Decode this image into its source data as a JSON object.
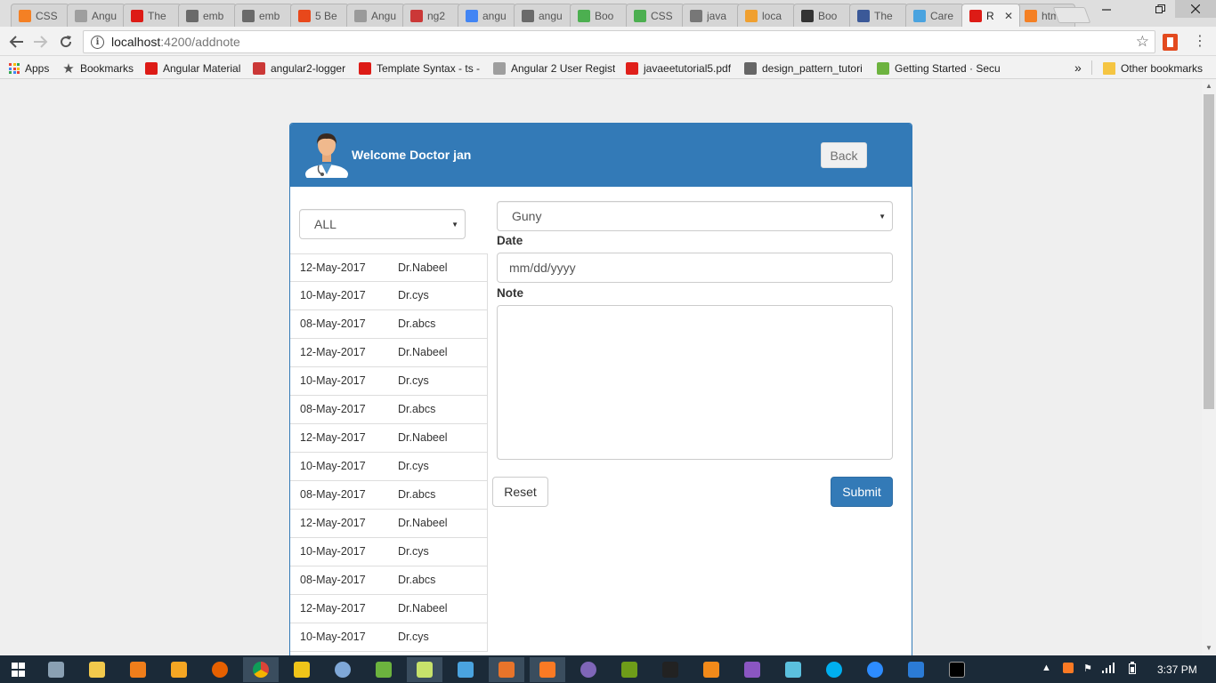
{
  "browser": {
    "tabs": [
      {
        "label": "CSS",
        "icon": "stackoverflow-icon",
        "color": "#f48024"
      },
      {
        "label": "Angu",
        "icon": "user-silhouette-icon",
        "color": "#9e9e9e"
      },
      {
        "label": "The",
        "icon": "angular-icon",
        "color": "#dd1b16"
      },
      {
        "label": "emb",
        "icon": "download-icon",
        "color": "#6a6a6a"
      },
      {
        "label": "emb",
        "icon": "download-icon",
        "color": "#6a6a6a"
      },
      {
        "label": "5 Be",
        "icon": "as-icon",
        "color": "#e8481b"
      },
      {
        "label": "Angu",
        "icon": "page-icon",
        "color": "#9a9a9a"
      },
      {
        "label": "ng2",
        "icon": "npm-icon",
        "color": "#cb3837"
      },
      {
        "label": "angu",
        "icon": "google-icon",
        "color": "#4285f4"
      },
      {
        "label": "angu",
        "icon": "download-icon",
        "color": "#6a6a6a"
      },
      {
        "label": "Boo",
        "icon": "w3-icon",
        "color": "#4caf50"
      },
      {
        "label": "CSS",
        "icon": "w3-icon",
        "color": "#4caf50"
      },
      {
        "label": "java",
        "icon": "t-icon",
        "color": "#777777"
      },
      {
        "label": "loca",
        "icon": "pma-icon",
        "color": "#f0a030"
      },
      {
        "label": "Boo",
        "icon": "github-icon",
        "color": "#333333"
      },
      {
        "label": "The",
        "icon": "facebook-icon",
        "color": "#3b5998"
      },
      {
        "label": "Care",
        "icon": "shield-icon",
        "color": "#4aa3df"
      },
      {
        "label": "R",
        "icon": "angular-icon",
        "color": "#dd1b16",
        "active": true
      },
      {
        "label": "htm",
        "icon": "stackoverflow-icon",
        "color": "#f48024"
      }
    ],
    "url_host": "localhost",
    "url_path": ":4200/addnote",
    "bookmarks": [
      {
        "label": "Apps",
        "icon": "apps-grid-icon",
        "color": "#4285f4"
      },
      {
        "label": "Bookmarks",
        "icon": "star-icon",
        "color": "#555555"
      },
      {
        "label": "Angular Material",
        "icon": "angular-icon",
        "color": "#dd1b16"
      },
      {
        "label": "angular2-logger",
        "icon": "npm-icon",
        "color": "#cb3837"
      },
      {
        "label": "Template Syntax - ts -",
        "icon": "angular-icon",
        "color": "#dd1b16"
      },
      {
        "label": "Angular 2 User Regist",
        "icon": "user-silhouette-icon",
        "color": "#9e9e9e"
      },
      {
        "label": "javaeetutorial5.pdf",
        "icon": "oracle-icon",
        "color": "#e0201b"
      },
      {
        "label": "design_pattern_tutori",
        "icon": "diamond-icon",
        "color": "#666666"
      },
      {
        "label": "Getting Started · Secu",
        "icon": "spring-icon",
        "color": "#6db33f"
      }
    ],
    "overflow_label": "»",
    "other_bookmarks": "Other bookmarks",
    "other_bookmarks_color": "#f5c542"
  },
  "header": {
    "welcome": "Welcome Doctor jan",
    "back_label": "Back",
    "bg_color": "#337ab7"
  },
  "filter": {
    "selected": "ALL"
  },
  "notes": [
    {
      "date": "12-May-2017",
      "doctor": "Dr.Nabeel"
    },
    {
      "date": "10-May-2017",
      "doctor": "Dr.cys"
    },
    {
      "date": "08-May-2017",
      "doctor": "Dr.abcs"
    },
    {
      "date": "12-May-2017",
      "doctor": "Dr.Nabeel"
    },
    {
      "date": "10-May-2017",
      "doctor": "Dr.cys"
    },
    {
      "date": "08-May-2017",
      "doctor": "Dr.abcs"
    },
    {
      "date": "12-May-2017",
      "doctor": "Dr.Nabeel"
    },
    {
      "date": "10-May-2017",
      "doctor": "Dr.cys"
    },
    {
      "date": "08-May-2017",
      "doctor": "Dr.abcs"
    },
    {
      "date": "12-May-2017",
      "doctor": "Dr.Nabeel"
    },
    {
      "date": "10-May-2017",
      "doctor": "Dr.cys"
    },
    {
      "date": "08-May-2017",
      "doctor": "Dr.abcs"
    },
    {
      "date": "12-May-2017",
      "doctor": "Dr.Nabeel"
    },
    {
      "date": "10-May-2017",
      "doctor": "Dr.cys"
    }
  ],
  "form": {
    "patient_selected": "Guny",
    "date_label": "Date",
    "date_placeholder": "mm/dd/yyyy",
    "note_label": "Note",
    "note_value": "",
    "reset_label": "Reset",
    "submit_label": "Submit",
    "submit_color": "#337ab7"
  },
  "taskbar": {
    "apps": [
      {
        "name": "start-icon",
        "color": "#ffffff"
      },
      {
        "name": "desktop-icon",
        "color": "#8aa0b3"
      },
      {
        "name": "file-explorer-icon",
        "color": "#f2c94c"
      },
      {
        "name": "vlc-icon",
        "color": "#f07e1b"
      },
      {
        "name": "speedometer-icon",
        "color": "#f5a623"
      },
      {
        "name": "firefox-icon",
        "color": "#e66000"
      },
      {
        "name": "chrome-icon",
        "color": "#4caf50"
      },
      {
        "name": "git-icon",
        "color": "#f0c419"
      },
      {
        "name": "network-icon",
        "color": "#7fa8d8"
      },
      {
        "name": "green-app-icon",
        "color": "#6cb33e"
      },
      {
        "name": "notepad-icon",
        "color": "#c7e26b"
      },
      {
        "name": "wireshark-icon",
        "color": "#4aa3df"
      },
      {
        "name": "orange-ring-icon",
        "color": "#e8742a"
      },
      {
        "name": "xampp-icon",
        "color": "#fb7a24"
      },
      {
        "name": "eclipse-icon",
        "color": "#7f66b8"
      },
      {
        "name": "dreamweaver-icon",
        "color": "#6e9c19"
      },
      {
        "name": "intellij-icon",
        "color": "#222222"
      },
      {
        "name": "sublime-icon",
        "color": "#f28a1a"
      },
      {
        "name": "visual-studio-icon",
        "color": "#8a56c2"
      },
      {
        "name": "chat-icon",
        "color": "#5bc0de"
      },
      {
        "name": "skype-icon",
        "color": "#00aff0"
      },
      {
        "name": "camera-icon",
        "color": "#2d8cff"
      },
      {
        "name": "vscode-icon",
        "color": "#2b7bd6"
      },
      {
        "name": "cmd-icon",
        "color": "#000000"
      }
    ],
    "clock": "3:37 PM"
  }
}
